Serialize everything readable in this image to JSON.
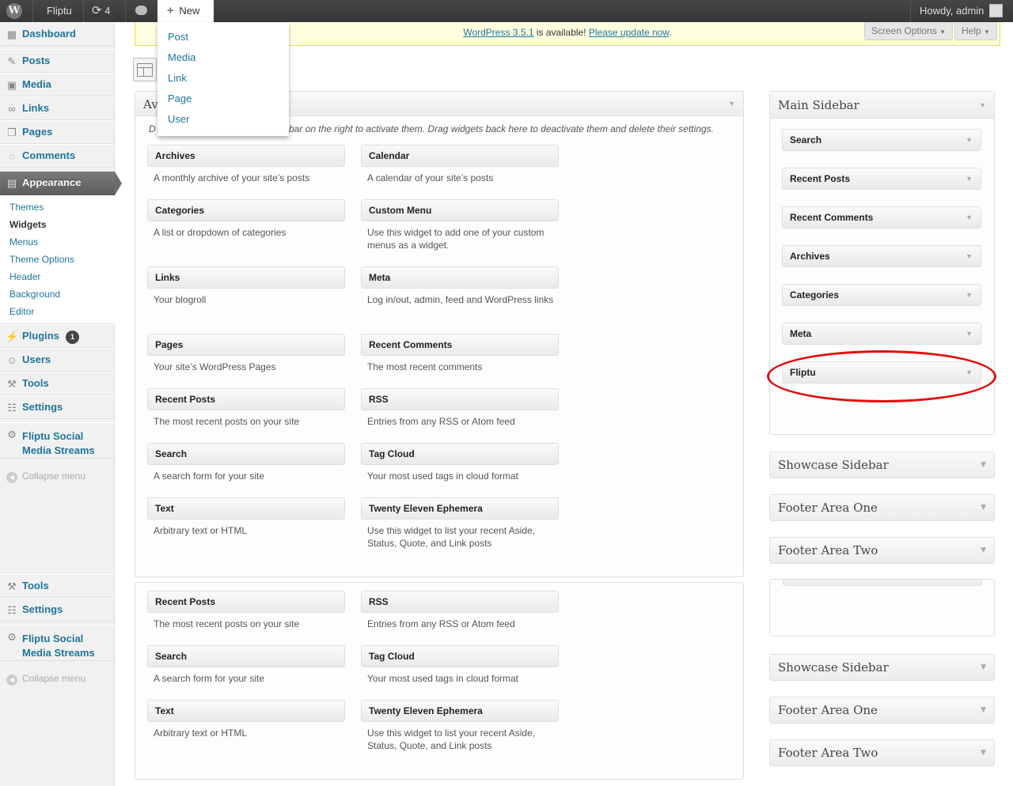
{
  "admin_bar": {
    "site_name": "Fliptu",
    "updates_count": "4",
    "new_label": "New",
    "howdy": "Howdy, admin",
    "new_menu": [
      "Post",
      "Media",
      "Link",
      "Page",
      "User"
    ]
  },
  "sidebar": {
    "dashboard": "Dashboard",
    "posts": "Posts",
    "media": "Media",
    "links": "Links",
    "pages": "Pages",
    "comments": "Comments",
    "appearance": "Appearance",
    "appearance_sub": [
      "Themes",
      "Widgets",
      "Menus",
      "Theme Options",
      "Header",
      "Background",
      "Editor"
    ],
    "plugins": "Plugins",
    "plugins_badge": "1",
    "users": "Users",
    "tools": "Tools",
    "settings": "Settings",
    "fliptu_line1": "Fliptu Social",
    "fliptu_line2": "Media Streams",
    "collapse": "Collapse menu"
  },
  "notice": {
    "version_link": "WordPress 3.5.1",
    "middle": "is available!",
    "update_link": "Please update now",
    "end": "."
  },
  "top_buttons": {
    "screen_options": "Screen Options",
    "help": "Help"
  },
  "available": {
    "title_fragment": "Av",
    "desc_start": "D",
    "desc_visible": "bar on the right to activate them. Drag widgets back here to deactivate them and delete their settings."
  },
  "widgets": [
    {
      "title": "Archives",
      "desc": "A monthly archive of your site’s posts"
    },
    {
      "title": "Calendar",
      "desc": "A calendar of your site’s posts"
    },
    {
      "title": "Categories",
      "desc": "A list or dropdown of categories"
    },
    {
      "title": "Custom Menu",
      "desc": "Use this widget to add one of your custom menus as a widget."
    },
    {
      "title": "Links",
      "desc": "Your blogroll"
    },
    {
      "title": "Meta",
      "desc": "Log in/out, admin, feed and WordPress links"
    },
    {
      "title": "Pages",
      "desc": "Your site’s WordPress Pages"
    },
    {
      "title": "Recent Comments",
      "desc": "The most recent comments"
    },
    {
      "title": "Recent Posts",
      "desc": "The most recent posts on your site"
    },
    {
      "title": "RSS",
      "desc": "Entries from any RSS or Atom feed"
    },
    {
      "title": "Search",
      "desc": "A search form for your site"
    },
    {
      "title": "Tag Cloud",
      "desc": "Your most used tags in cloud format"
    },
    {
      "title": "Text",
      "desc": "Arbitrary text or HTML"
    },
    {
      "title": "Twenty Eleven Ephemera",
      "desc": "Use this widget to list your recent Aside, Status, Quote, and Link posts"
    }
  ],
  "main_sidebar": {
    "title": "Main Sidebar",
    "widgets": [
      "Search",
      "Recent Posts",
      "Recent Comments",
      "Archives",
      "Categories",
      "Meta",
      "Fliptu"
    ]
  },
  "other_sidebars": [
    "Showcase Sidebar",
    "Footer Area One",
    "Footer Area Two"
  ]
}
